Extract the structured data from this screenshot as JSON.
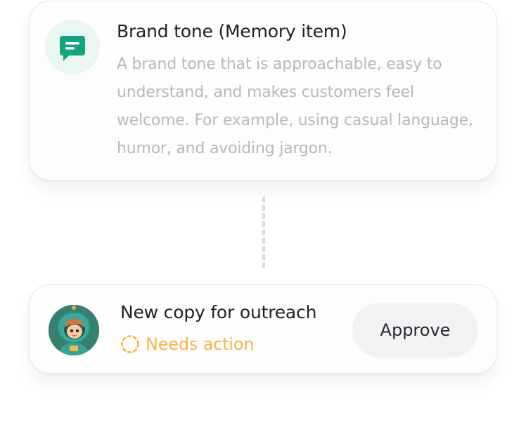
{
  "memory_card": {
    "title": "Brand tone (Memory item)",
    "description": "A brand tone that is approachable, easy to understand, and makes customers feel welcome. For example, using casual language, humor, and avoiding jargon.",
    "icon": "message-icon"
  },
  "task_card": {
    "title": "New copy for outreach",
    "status": "Needs action",
    "status_icon": "dashed-circle-icon",
    "approve_label": "Approve",
    "avatar": "astronaut-avatar"
  },
  "colors": {
    "accent_green": "#14a37f",
    "icon_bg": "#e9f6f2",
    "status_orange": "#f7b44a",
    "muted_text": "#b8b8bd",
    "title_text": "#202124"
  }
}
